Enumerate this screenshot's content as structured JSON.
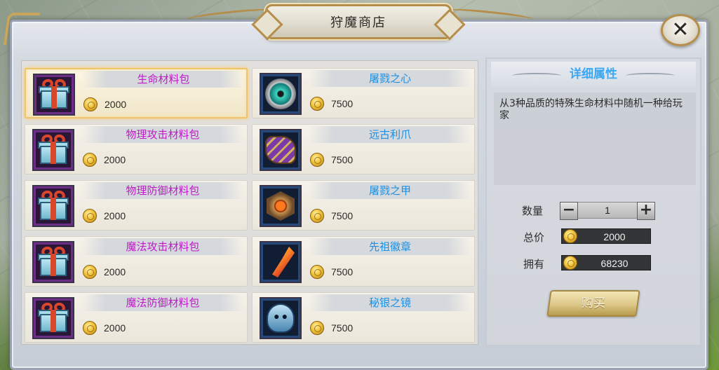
{
  "shop": {
    "title": "狩魔商店",
    "close_label": "✕"
  },
  "items_left": [
    {
      "name": "生命材料包",
      "price": "2000",
      "icon": "gift-box-icon",
      "quality": "purple",
      "selected": true
    },
    {
      "name": "物理攻击材料包",
      "price": "2000",
      "icon": "gift-box-icon",
      "quality": "purple"
    },
    {
      "name": "物理防御材料包",
      "price": "2000",
      "icon": "gift-box-icon",
      "quality": "purple"
    },
    {
      "name": "魔法攻击材料包",
      "price": "2000",
      "icon": "gift-box-icon",
      "quality": "purple"
    },
    {
      "name": "魔法防御材料包",
      "price": "2000",
      "icon": "gift-box-icon",
      "quality": "purple"
    }
  ],
  "items_right": [
    {
      "name": "屠戮之心",
      "price": "7500",
      "icon": "dragon-eye-icon",
      "quality": "blue"
    },
    {
      "name": "远古利爪",
      "price": "7500",
      "icon": "claw-icon",
      "quality": "blue"
    },
    {
      "name": "屠戮之甲",
      "price": "7500",
      "icon": "armor-emblem-icon",
      "quality": "blue"
    },
    {
      "name": "先祖徽章",
      "price": "7500",
      "icon": "feather-icon",
      "quality": "blue"
    },
    {
      "name": "秘银之镜",
      "price": "7500",
      "icon": "skull-mirror-icon",
      "quality": "blue"
    }
  ],
  "detail": {
    "header": "详细属性",
    "description": "从3种品质的特殊生命材料中随机一种给玩家",
    "quantity_label": "数量",
    "quantity_value": "1",
    "minus": "−",
    "plus": "+",
    "total_label": "总价",
    "total_value": "2000",
    "owned_label": "拥有",
    "owned_value": "68230",
    "buy_label": "购买"
  },
  "colors": {
    "purple_name": "#c118c9",
    "blue_name": "#1d8fe0",
    "header_blue": "#3ca7f0",
    "gold_border": "#b58e4c"
  }
}
